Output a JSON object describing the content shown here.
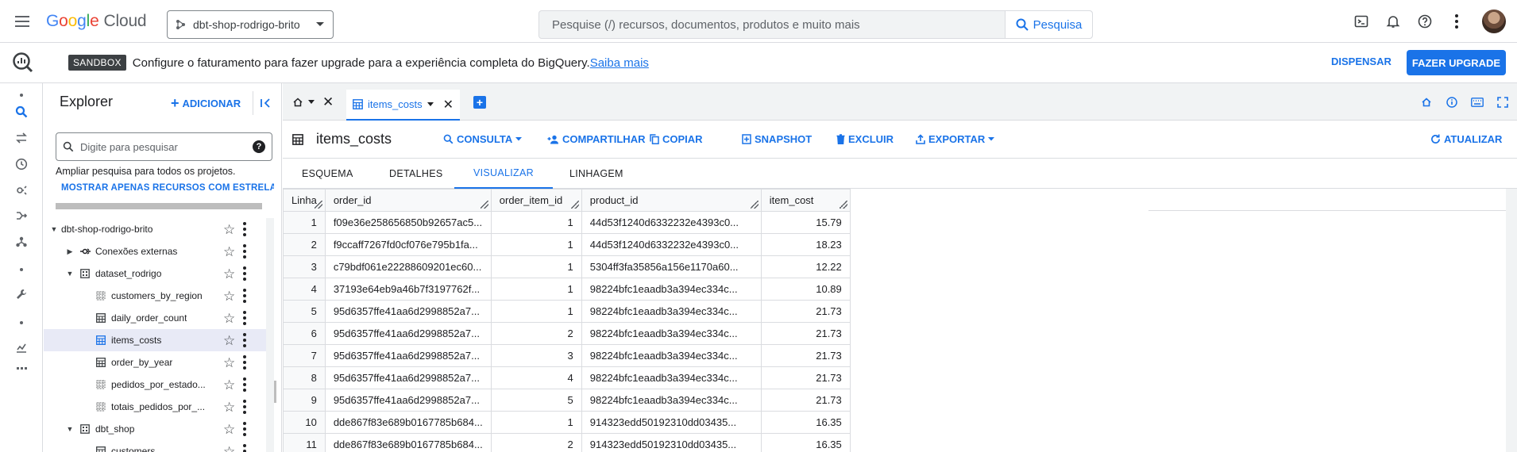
{
  "header": {
    "logo_google": [
      "G",
      "o",
      "o",
      "g",
      "l",
      "e"
    ],
    "logo_cloud": "Cloud",
    "project": "dbt-shop-rodrigo-brito",
    "search_placeholder": "Pesquise (/) recursos, documentos, produtos e muito mais",
    "search_button": "Pesquisa"
  },
  "banner": {
    "badge": "SANDBOX",
    "text": "Configure o faturamento para fazer upgrade para a experiência completa do BigQuery.",
    "link": "Saiba mais",
    "dismiss": "DISPENSAR",
    "upgrade": "FAZER UPGRADE"
  },
  "explorer": {
    "title": "Explorer",
    "add": "ADICIONAR",
    "search_placeholder": "Digite para pesquisar",
    "hint": "Ampliar pesquisa para todos os projetos.",
    "star_link": "MOSTRAR APENAS RECURSOS COM ESTRELA",
    "tree": [
      {
        "label": "dbt-shop-rodrigo-brito",
        "level": 0,
        "type": "project",
        "expanded": true
      },
      {
        "label": "Conexões externas",
        "level": 1,
        "type": "connection",
        "expanded": false
      },
      {
        "label": "dataset_rodrigo",
        "level": 1,
        "type": "dataset",
        "expanded": true
      },
      {
        "label": "customers_by_region",
        "level": 2,
        "type": "view"
      },
      {
        "label": "daily_order_count",
        "level": 2,
        "type": "table"
      },
      {
        "label": "items_costs",
        "level": 2,
        "type": "table",
        "selected": true
      },
      {
        "label": "order_by_year",
        "level": 2,
        "type": "table"
      },
      {
        "label": "pedidos_por_estado...",
        "level": 2,
        "type": "view"
      },
      {
        "label": "totais_pedidos_por_...",
        "level": 2,
        "type": "view"
      },
      {
        "label": "dbt_shop",
        "level": 1,
        "type": "dataset",
        "expanded": true
      },
      {
        "label": "customers",
        "level": 2,
        "type": "table"
      }
    ]
  },
  "workspace": {
    "tab": "items_costs",
    "table_name": "items_costs",
    "toolbar": {
      "consulta": "CONSULTA",
      "compartilhar": "COMPARTILHAR",
      "copiar": "COPIAR",
      "snapshot": "SNAPSHOT",
      "excluir": "EXCLUIR",
      "exportar": "EXPORTAR",
      "atualizar": "ATUALIZAR"
    },
    "subtabs": [
      "ESQUEMA",
      "DETALHES",
      "VISUALIZAR",
      "LINHAGEM"
    ],
    "active_subtab": "VISUALIZAR"
  },
  "grid": {
    "columns": [
      "Linha",
      "order_id",
      "order_item_id",
      "product_id",
      "item_cost"
    ],
    "rows": [
      [
        "1",
        "f09e36e258656850b92657ac5...",
        "1",
        "44d53f1240d6332232e4393c0...",
        "15.79"
      ],
      [
        "2",
        "f9ccaff7267fd0cf076e795b1fa...",
        "1",
        "44d53f1240d6332232e4393c0...",
        "18.23"
      ],
      [
        "3",
        "c79bdf061e22288609201ec60...",
        "1",
        "5304ff3fa35856a156e1170a60...",
        "12.22"
      ],
      [
        "4",
        "37193e64eb9a46b7f3197762f...",
        "1",
        "98224bfc1eaadb3a394ec334c...",
        "10.89"
      ],
      [
        "5",
        "95d6357ffe41aa6d2998852a7...",
        "1",
        "98224bfc1eaadb3a394ec334c...",
        "21.73"
      ],
      [
        "6",
        "95d6357ffe41aa6d2998852a7...",
        "2",
        "98224bfc1eaadb3a394ec334c...",
        "21.73"
      ],
      [
        "7",
        "95d6357ffe41aa6d2998852a7...",
        "3",
        "98224bfc1eaadb3a394ec334c...",
        "21.73"
      ],
      [
        "8",
        "95d6357ffe41aa6d2998852a7...",
        "4",
        "98224bfc1eaadb3a394ec334c...",
        "21.73"
      ],
      [
        "9",
        "95d6357ffe41aa6d2998852a7...",
        "5",
        "98224bfc1eaadb3a394ec334c...",
        "21.73"
      ],
      [
        "10",
        "dde867f83e689b0167785b684...",
        "1",
        "914323edd50192310dd03435...",
        "16.35"
      ],
      [
        "11",
        "dde867f83e689b0167785b684...",
        "2",
        "914323edd50192310dd03435...",
        "16.35"
      ]
    ]
  },
  "colors": {
    "accent": "#1a73e8",
    "selected_row": "#e8eaf6",
    "sandbox_badge": "#3c4043"
  }
}
